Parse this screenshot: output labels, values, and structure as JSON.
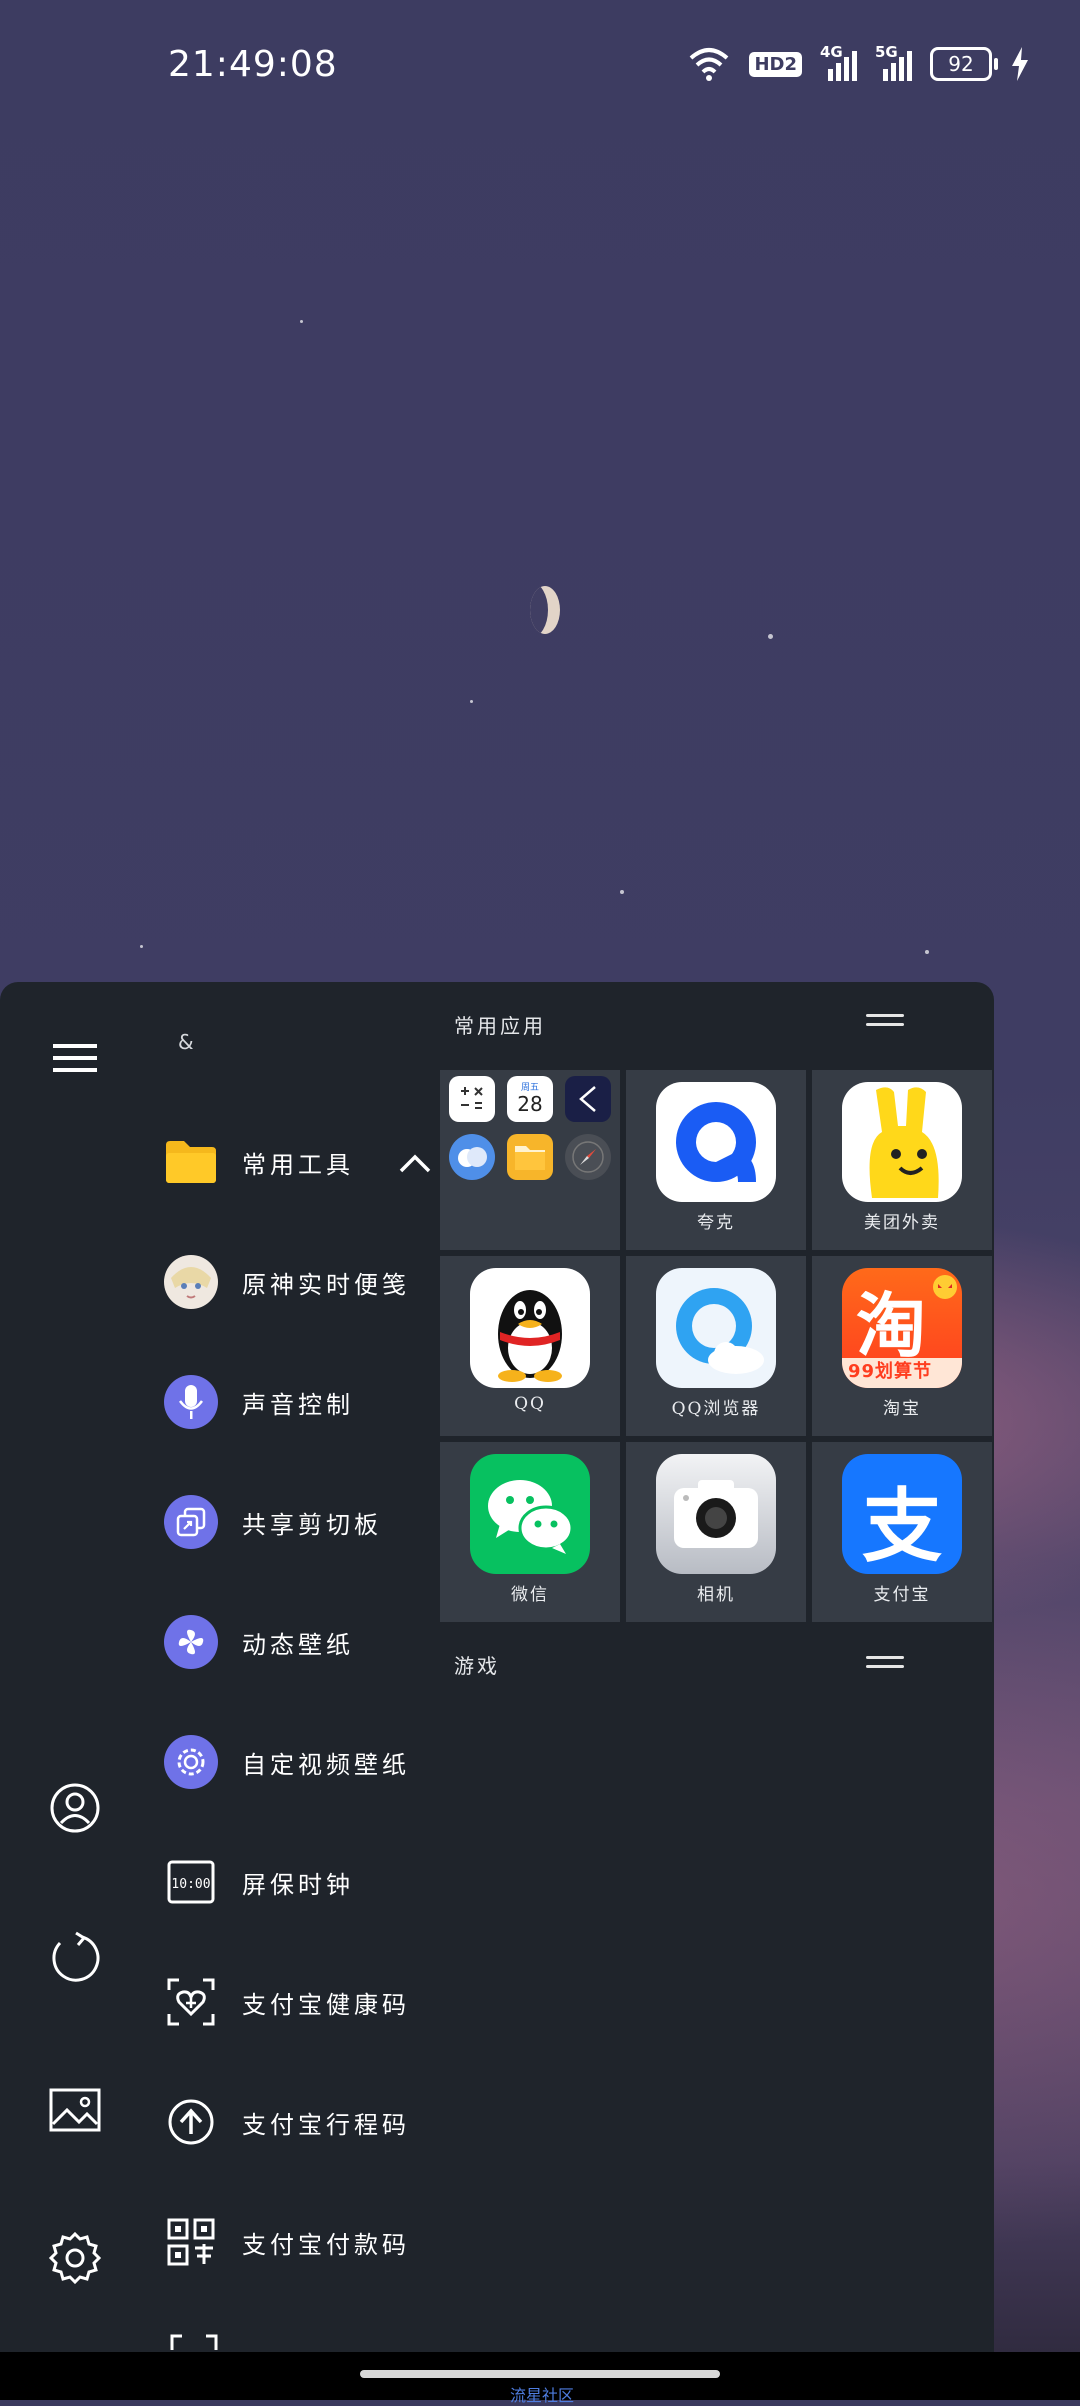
{
  "status_bar": {
    "time": "21:49:08",
    "hd_badge": "HD2",
    "net1": "4G",
    "net2": "5G",
    "battery": "92"
  },
  "panel": {
    "amp": "&",
    "folder": {
      "label": "常用工具"
    },
    "menu_items": [
      {
        "label": "原神实时便笺",
        "icon": "genshin-avatar-icon"
      },
      {
        "label": "声音控制",
        "icon": "microphone-icon"
      },
      {
        "label": "共享剪切板",
        "icon": "clipboard-share-icon"
      },
      {
        "label": "动态壁纸",
        "icon": "pinwheel-icon"
      },
      {
        "label": "自定视频壁纸",
        "icon": "video-gear-icon"
      },
      {
        "label": "屏保时钟",
        "icon": "clock-display-icon"
      },
      {
        "label": "支付宝健康码",
        "icon": "health-code-icon"
      },
      {
        "label": "支付宝行程码",
        "icon": "trip-arrow-icon"
      },
      {
        "label": "支付宝付款码",
        "icon": "pay-qr-icon"
      }
    ],
    "sections": {
      "frequent_apps": "常用应用",
      "games": "游戏"
    },
    "folder_date": {
      "weekday": "周五",
      "day": "28"
    },
    "apps": [
      {
        "label": "夸克",
        "icon": "quark-icon"
      },
      {
        "label": "美团外卖",
        "icon": "meituan-icon"
      },
      {
        "label": "QQ",
        "icon": "qq-icon"
      },
      {
        "label": "QQ浏览器",
        "icon": "qq-browser-icon"
      },
      {
        "label": "淘宝",
        "icon": "taobao-icon"
      },
      {
        "label": "微信",
        "icon": "wechat-icon"
      },
      {
        "label": "相机",
        "icon": "camera-icon"
      },
      {
        "label": "支付宝",
        "icon": "alipay-icon"
      }
    ],
    "taobao_banner": "99划算节",
    "taobao_char": "淘",
    "alipay_char": "支"
  },
  "nav": {
    "watermark": "流星社区"
  },
  "colors": {
    "panel_bg": "#1f242b",
    "cell_bg": "#363c45",
    "accent": "#6f72e8"
  }
}
